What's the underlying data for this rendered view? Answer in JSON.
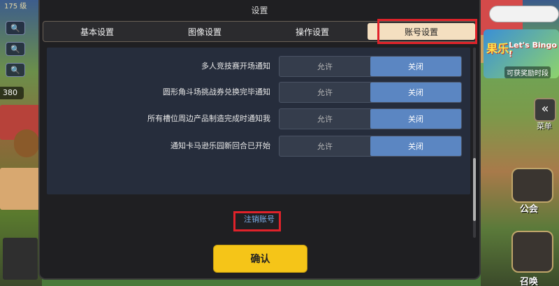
{
  "background": {
    "level_text": "175 级",
    "coin_count": "380",
    "bingo_title": "果乐,",
    "bingo_tag": "Let's Bingo !",
    "bingo_reward": "可获奖励时段",
    "menu_label": "菜单",
    "guild_label": "公会",
    "summon_label": "召唤"
  },
  "dialog": {
    "title": "设置",
    "tabs": [
      {
        "label": "基本设置",
        "active": false
      },
      {
        "label": "图像设置",
        "active": false
      },
      {
        "label": "操作设置",
        "active": false
      },
      {
        "label": "账号设置",
        "active": true
      }
    ],
    "settings": [
      {
        "label": "多人竞技赛开场通知",
        "allow": "允许",
        "close": "关闭",
        "selected": "close"
      },
      {
        "label": "圆形角斗场挑战券兑换完毕通知",
        "allow": "允许",
        "close": "关闭",
        "selected": "close"
      },
      {
        "label": "所有槽位周边产品制造完成时通知我",
        "allow": "允许",
        "close": "关闭",
        "selected": "close"
      },
      {
        "label": "通知卡马逊乐园新回合已开始",
        "allow": "允许",
        "close": "关闭",
        "selected": "close"
      }
    ],
    "logout_label": "注销账号",
    "confirm_label": "确认"
  },
  "colors": {
    "accent_blue": "#5b86c2",
    "tab_active": "#f4dfc0",
    "confirm_yellow": "#f5c518",
    "highlight_red": "#e0222a"
  }
}
